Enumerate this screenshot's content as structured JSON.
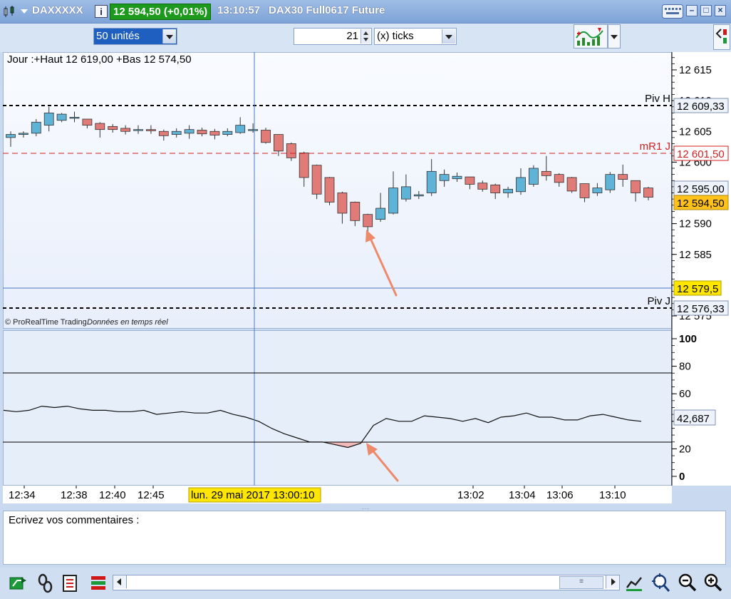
{
  "window": {
    "instrument": "DAXXXXX",
    "price_badge": "12 594,50 (+0,01%)",
    "time": "13:10:57",
    "contract": "DAX30 Full0617 Future"
  },
  "toolbar": {
    "units_value": "50 unités",
    "ticks_count": "21",
    "ticks_unit": "(x) ticks"
  },
  "chart": {
    "info_line": "Jour :+Haut 12 619,00 +Bas 12 574,50",
    "copyright": "© ProRealTime Trading",
    "realtime_note": "Données en temps réel",
    "price_ticks": [
      "12 615",
      "12 610",
      "12 605",
      "12 600",
      "12 595",
      "12 590",
      "12 585",
      "12 580",
      "12 575"
    ],
    "osc_ticks": [
      "100",
      "80",
      "60",
      "40",
      "20",
      "0"
    ],
    "time_labels": [
      "12:34",
      "12:38",
      "12:40",
      "12:45",
      "13:02",
      "13:04",
      "13:06",
      "13:10"
    ],
    "cursor_time": "lun. 29 mai 2017 13:00:10",
    "levels": {
      "piv_h_label": "Piv H",
      "piv_h_value": "12 609,33",
      "mr1_label": "mR1 J",
      "mr1_value": "12 601,50",
      "price_a": "12 595,00",
      "last_price": "12 594,50",
      "cursor_price": "12 579,5",
      "piv_j_label": "Piv J",
      "piv_j_value": "12 576,33"
    },
    "osc_value": "42,687"
  },
  "comments": {
    "placeholder": "Ecrivez vos commentaires :"
  },
  "colors": {
    "up": "#5fb3d6",
    "down": "#e07b78",
    "badge": "#1d9a1d",
    "mr1": "#d02020",
    "highlight": "#ffe600"
  },
  "chart_data": {
    "type": "candlestick",
    "candles": [
      {
        "o": 12604.0,
        "c": 12604.5,
        "h": 12605.0,
        "l": 12602.5
      },
      {
        "o": 12604.5,
        "c": 12604.7,
        "h": 12605.0,
        "l": 12604.0
      },
      {
        "o": 12604.7,
        "c": 12606.5,
        "h": 12607.0,
        "l": 12604.2
      },
      {
        "o": 12606.0,
        "c": 12608.0,
        "h": 12609.0,
        "l": 12605.0
      },
      {
        "o": 12606.8,
        "c": 12607.8,
        "h": 12608.0,
        "l": 12606.5
      },
      {
        "o": 12607.3,
        "c": 12607.3,
        "h": 12608.2,
        "l": 12606.5
      },
      {
        "o": 12607.0,
        "c": 12606.0,
        "h": 12607.0,
        "l": 12605.5
      },
      {
        "o": 12606.3,
        "c": 12605.3,
        "h": 12606.5,
        "l": 12604.0
      },
      {
        "o": 12605.8,
        "c": 12605.3,
        "h": 12606.2,
        "l": 12604.8
      },
      {
        "o": 12605.5,
        "c": 12605.0,
        "h": 12606.0,
        "l": 12604.5
      },
      {
        "o": 12605.3,
        "c": 12605.3,
        "h": 12606.0,
        "l": 12604.6
      },
      {
        "o": 12605.3,
        "c": 12605.1,
        "h": 12606.0,
        "l": 12604.6
      },
      {
        "o": 12605.0,
        "c": 12604.3,
        "h": 12605.3,
        "l": 12603.5
      },
      {
        "o": 12604.5,
        "c": 12605.0,
        "h": 12605.5,
        "l": 12604.0
      },
      {
        "o": 12604.7,
        "c": 12605.3,
        "h": 12606.0,
        "l": 12603.8
      },
      {
        "o": 12605.2,
        "c": 12604.6,
        "h": 12605.6,
        "l": 12604.2
      },
      {
        "o": 12605.0,
        "c": 12604.4,
        "h": 12605.4,
        "l": 12603.7
      },
      {
        "o": 12604.5,
        "c": 12605.0,
        "h": 12605.5,
        "l": 12604.2
      },
      {
        "o": 12604.8,
        "c": 12606.0,
        "h": 12607.3,
        "l": 12604.6
      },
      {
        "o": 12605.2,
        "c": 12605.3,
        "h": 12606.3,
        "l": 12604.8
      },
      {
        "o": 12605.2,
        "c": 12603.2,
        "h": 12605.6,
        "l": 12603.0
      },
      {
        "o": 12604.5,
        "c": 12601.8,
        "h": 12604.5,
        "l": 12601.0
      },
      {
        "o": 12603.0,
        "c": 12600.7,
        "h": 12603.2,
        "l": 12600.2
      },
      {
        "o": 12601.5,
        "c": 12597.5,
        "h": 12601.7,
        "l": 12596.0
      },
      {
        "o": 12599.5,
        "c": 12594.8,
        "h": 12599.6,
        "l": 12594.0
      },
      {
        "o": 12597.5,
        "c": 12593.5,
        "h": 12597.6,
        "l": 12593.0
      },
      {
        "o": 12595.0,
        "c": 12591.7,
        "h": 12595.2,
        "l": 12590.0
      },
      {
        "o": 12593.5,
        "c": 12590.5,
        "h": 12593.6,
        "l": 12589.6
      },
      {
        "o": 12591.5,
        "c": 12589.5,
        "h": 12591.6,
        "l": 12588.6
      },
      {
        "o": 12590.7,
        "c": 12592.5,
        "h": 12595.0,
        "l": 12590.3
      },
      {
        "o": 12591.7,
        "c": 12595.8,
        "h": 12598.5,
        "l": 12591.5
      },
      {
        "o": 12594.0,
        "c": 12596.0,
        "h": 12598.0,
        "l": 12593.6
      },
      {
        "o": 12594.5,
        "c": 12594.7,
        "h": 12595.3,
        "l": 12594.0
      },
      {
        "o": 12595.0,
        "c": 12598.5,
        "h": 12600.5,
        "l": 12594.5
      },
      {
        "o": 12597.0,
        "c": 12598.0,
        "h": 12598.8,
        "l": 12596.0
      },
      {
        "o": 12597.3,
        "c": 12597.7,
        "h": 12598.3,
        "l": 12596.8
      },
      {
        "o": 12597.6,
        "c": 12596.4,
        "h": 12597.6,
        "l": 12595.6
      },
      {
        "o": 12596.6,
        "c": 12595.6,
        "h": 12597.0,
        "l": 12595.2
      },
      {
        "o": 12596.3,
        "c": 12595.0,
        "h": 12596.5,
        "l": 12594.0
      },
      {
        "o": 12595.0,
        "c": 12595.6,
        "h": 12596.0,
        "l": 12594.2
      },
      {
        "o": 12595.2,
        "c": 12597.5,
        "h": 12599.0,
        "l": 12594.7
      },
      {
        "o": 12596.4,
        "c": 12599.0,
        "h": 12599.5,
        "l": 12596.0
      },
      {
        "o": 12598.5,
        "c": 12597.8,
        "h": 12601.0,
        "l": 12597.0
      },
      {
        "o": 12598.0,
        "c": 12596.7,
        "h": 12598.2,
        "l": 12596.0
      },
      {
        "o": 12597.5,
        "c": 12595.3,
        "h": 12597.6,
        "l": 12595.0
      },
      {
        "o": 12596.5,
        "c": 12594.2,
        "h": 12596.5,
        "l": 12593.5
      },
      {
        "o": 12595.0,
        "c": 12595.8,
        "h": 12596.6,
        "l": 12594.5
      },
      {
        "o": 12595.5,
        "c": 12598.0,
        "h": 12598.4,
        "l": 12595.0
      },
      {
        "o": 12598.0,
        "c": 12597.2,
        "h": 12599.6,
        "l": 12596.0
      },
      {
        "o": 12597.0,
        "c": 12595.0,
        "h": 12597.0,
        "l": 12593.6
      },
      {
        "o": 12595.8,
        "c": 12594.3,
        "h": 12596.0,
        "l": 12593.8
      }
    ],
    "oscillator": [
      48,
      47,
      48,
      51,
      50,
      51,
      49,
      48,
      48,
      47,
      47,
      48,
      45,
      46,
      47,
      46,
      46,
      48,
      45,
      43,
      40,
      35,
      31,
      28,
      25,
      25,
      23,
      21,
      24,
      37,
      42,
      40,
      40,
      44,
      43,
      42,
      40,
      42,
      39,
      43,
      44,
      46,
      43,
      43,
      41,
      41,
      44,
      45,
      43,
      41,
      40
    ]
  }
}
